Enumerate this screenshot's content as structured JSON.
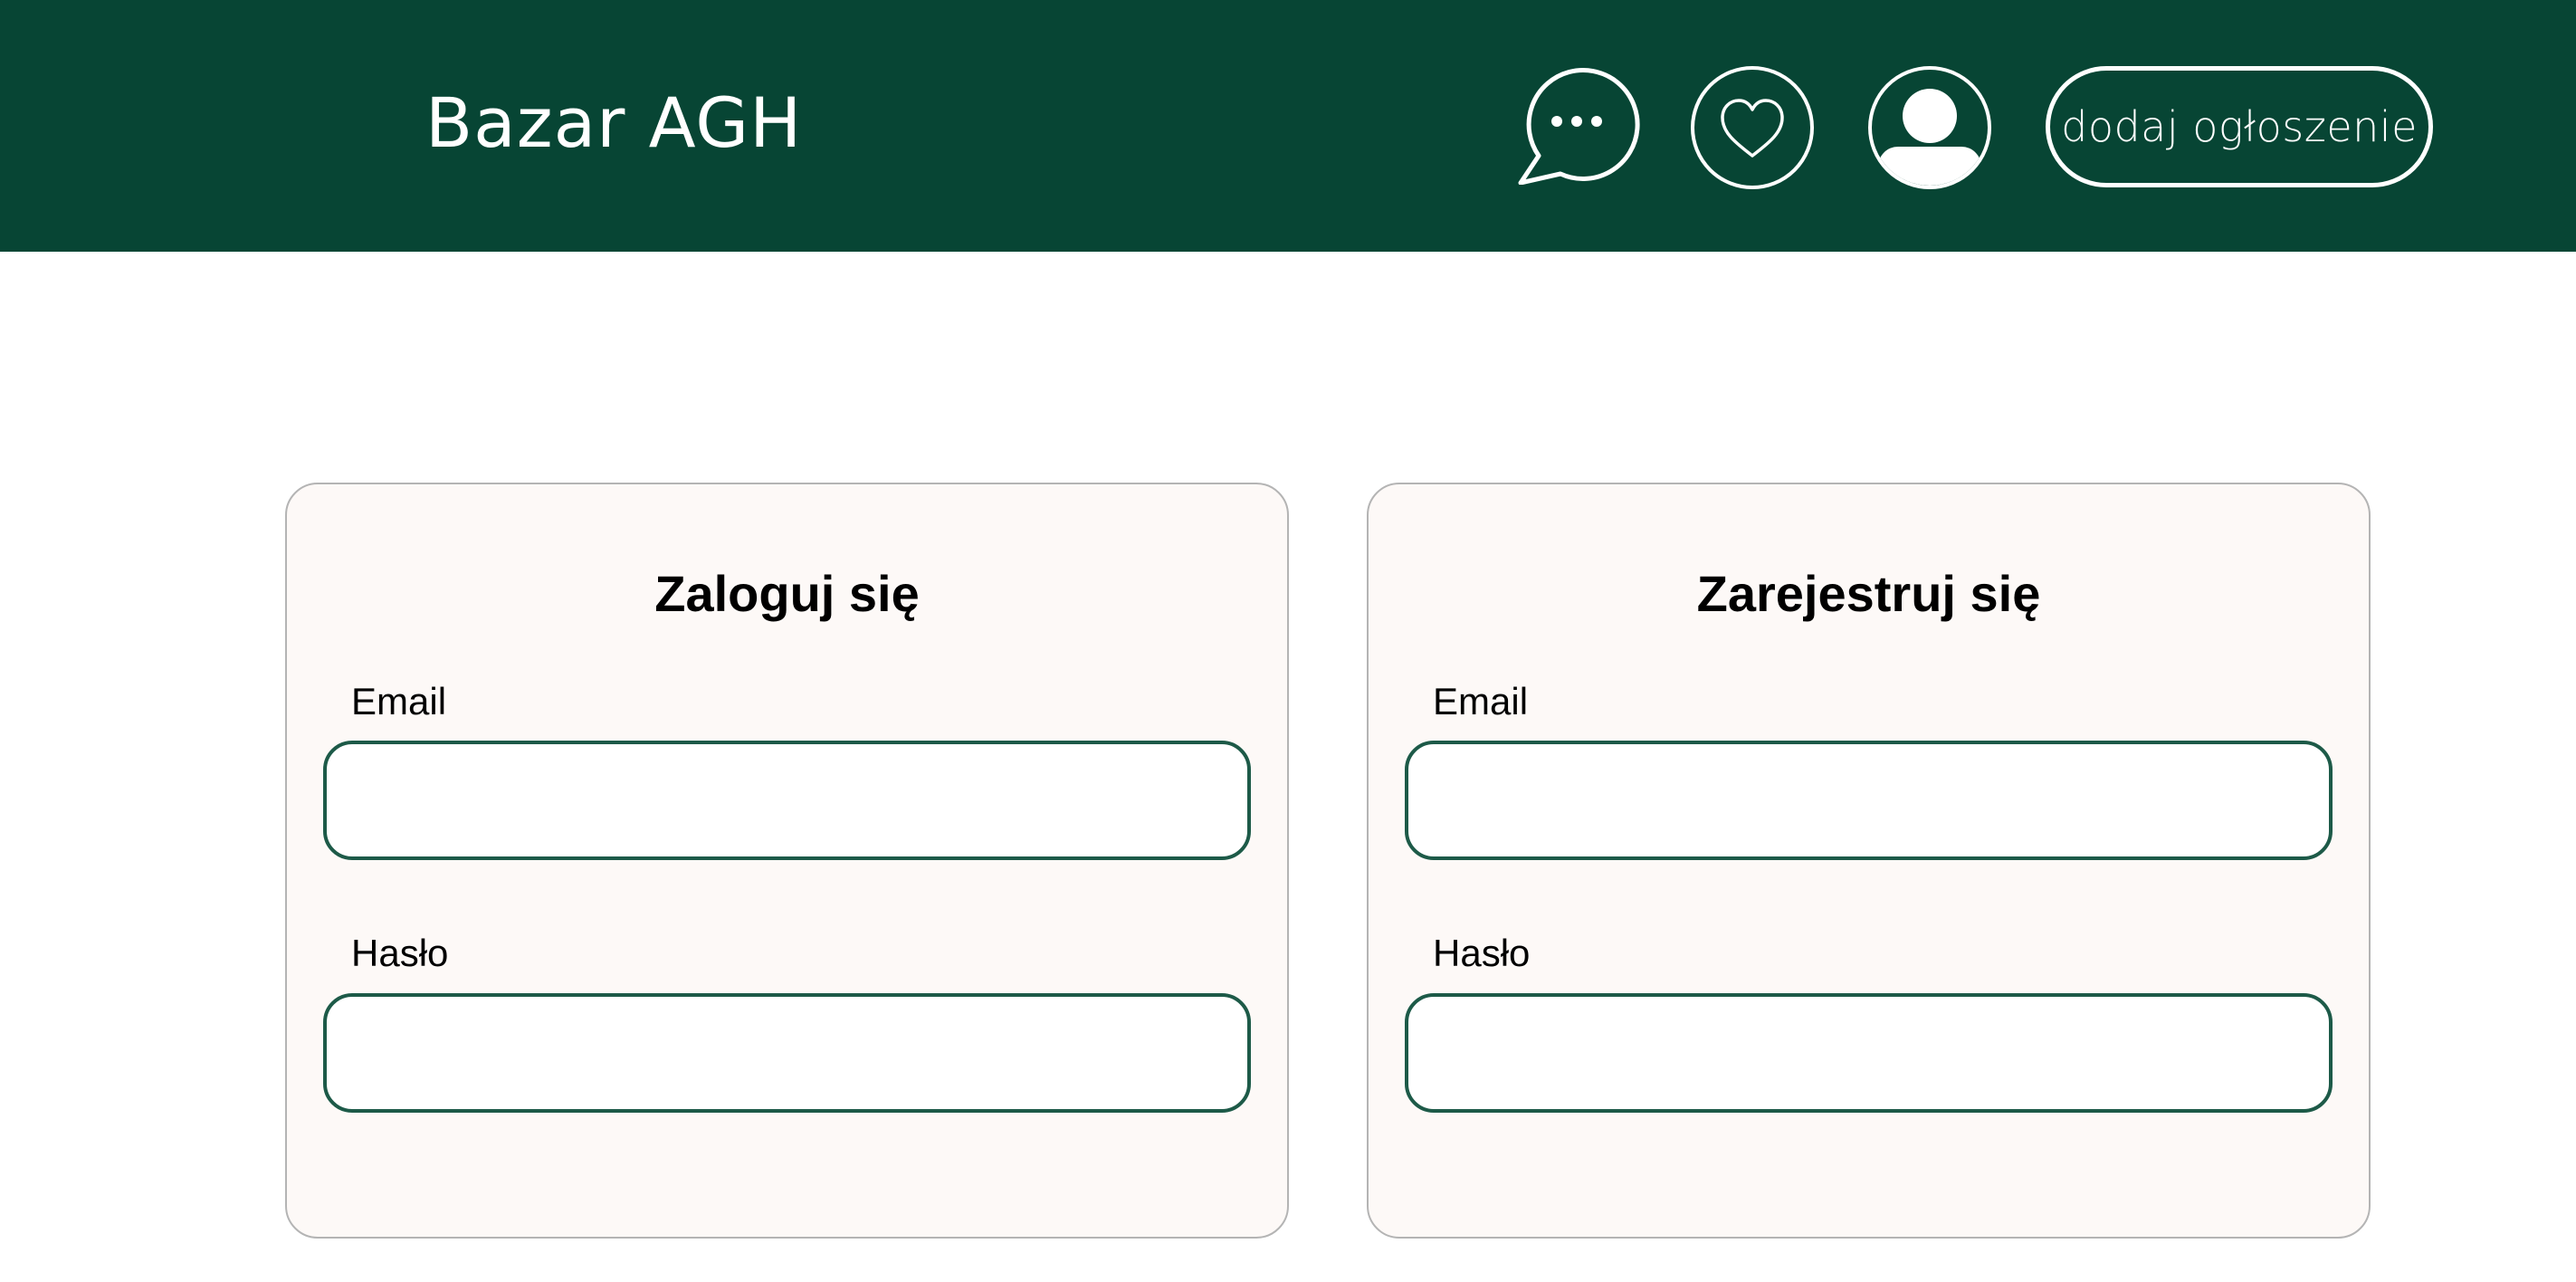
{
  "header": {
    "brand": "Bazar AGH",
    "icons": {
      "chat": "chat-bubble-icon",
      "favorites": "heart-icon",
      "profile": "user-icon"
    },
    "add_listing_label": "dodaj ogłoszenie"
  },
  "login": {
    "title": "Zaloguj się",
    "email_label": "Email",
    "email_value": "",
    "password_label": "Hasło",
    "password_value": ""
  },
  "register": {
    "title": "Zarejestruj się",
    "email_label": "Email",
    "email_value": "",
    "password_label": "Hasło",
    "password_value": ""
  },
  "colors": {
    "header_bg": "#074534",
    "card_bg": "#fdf9f7",
    "input_border": "#1d5a48",
    "card_border": "#b4b4b4"
  }
}
